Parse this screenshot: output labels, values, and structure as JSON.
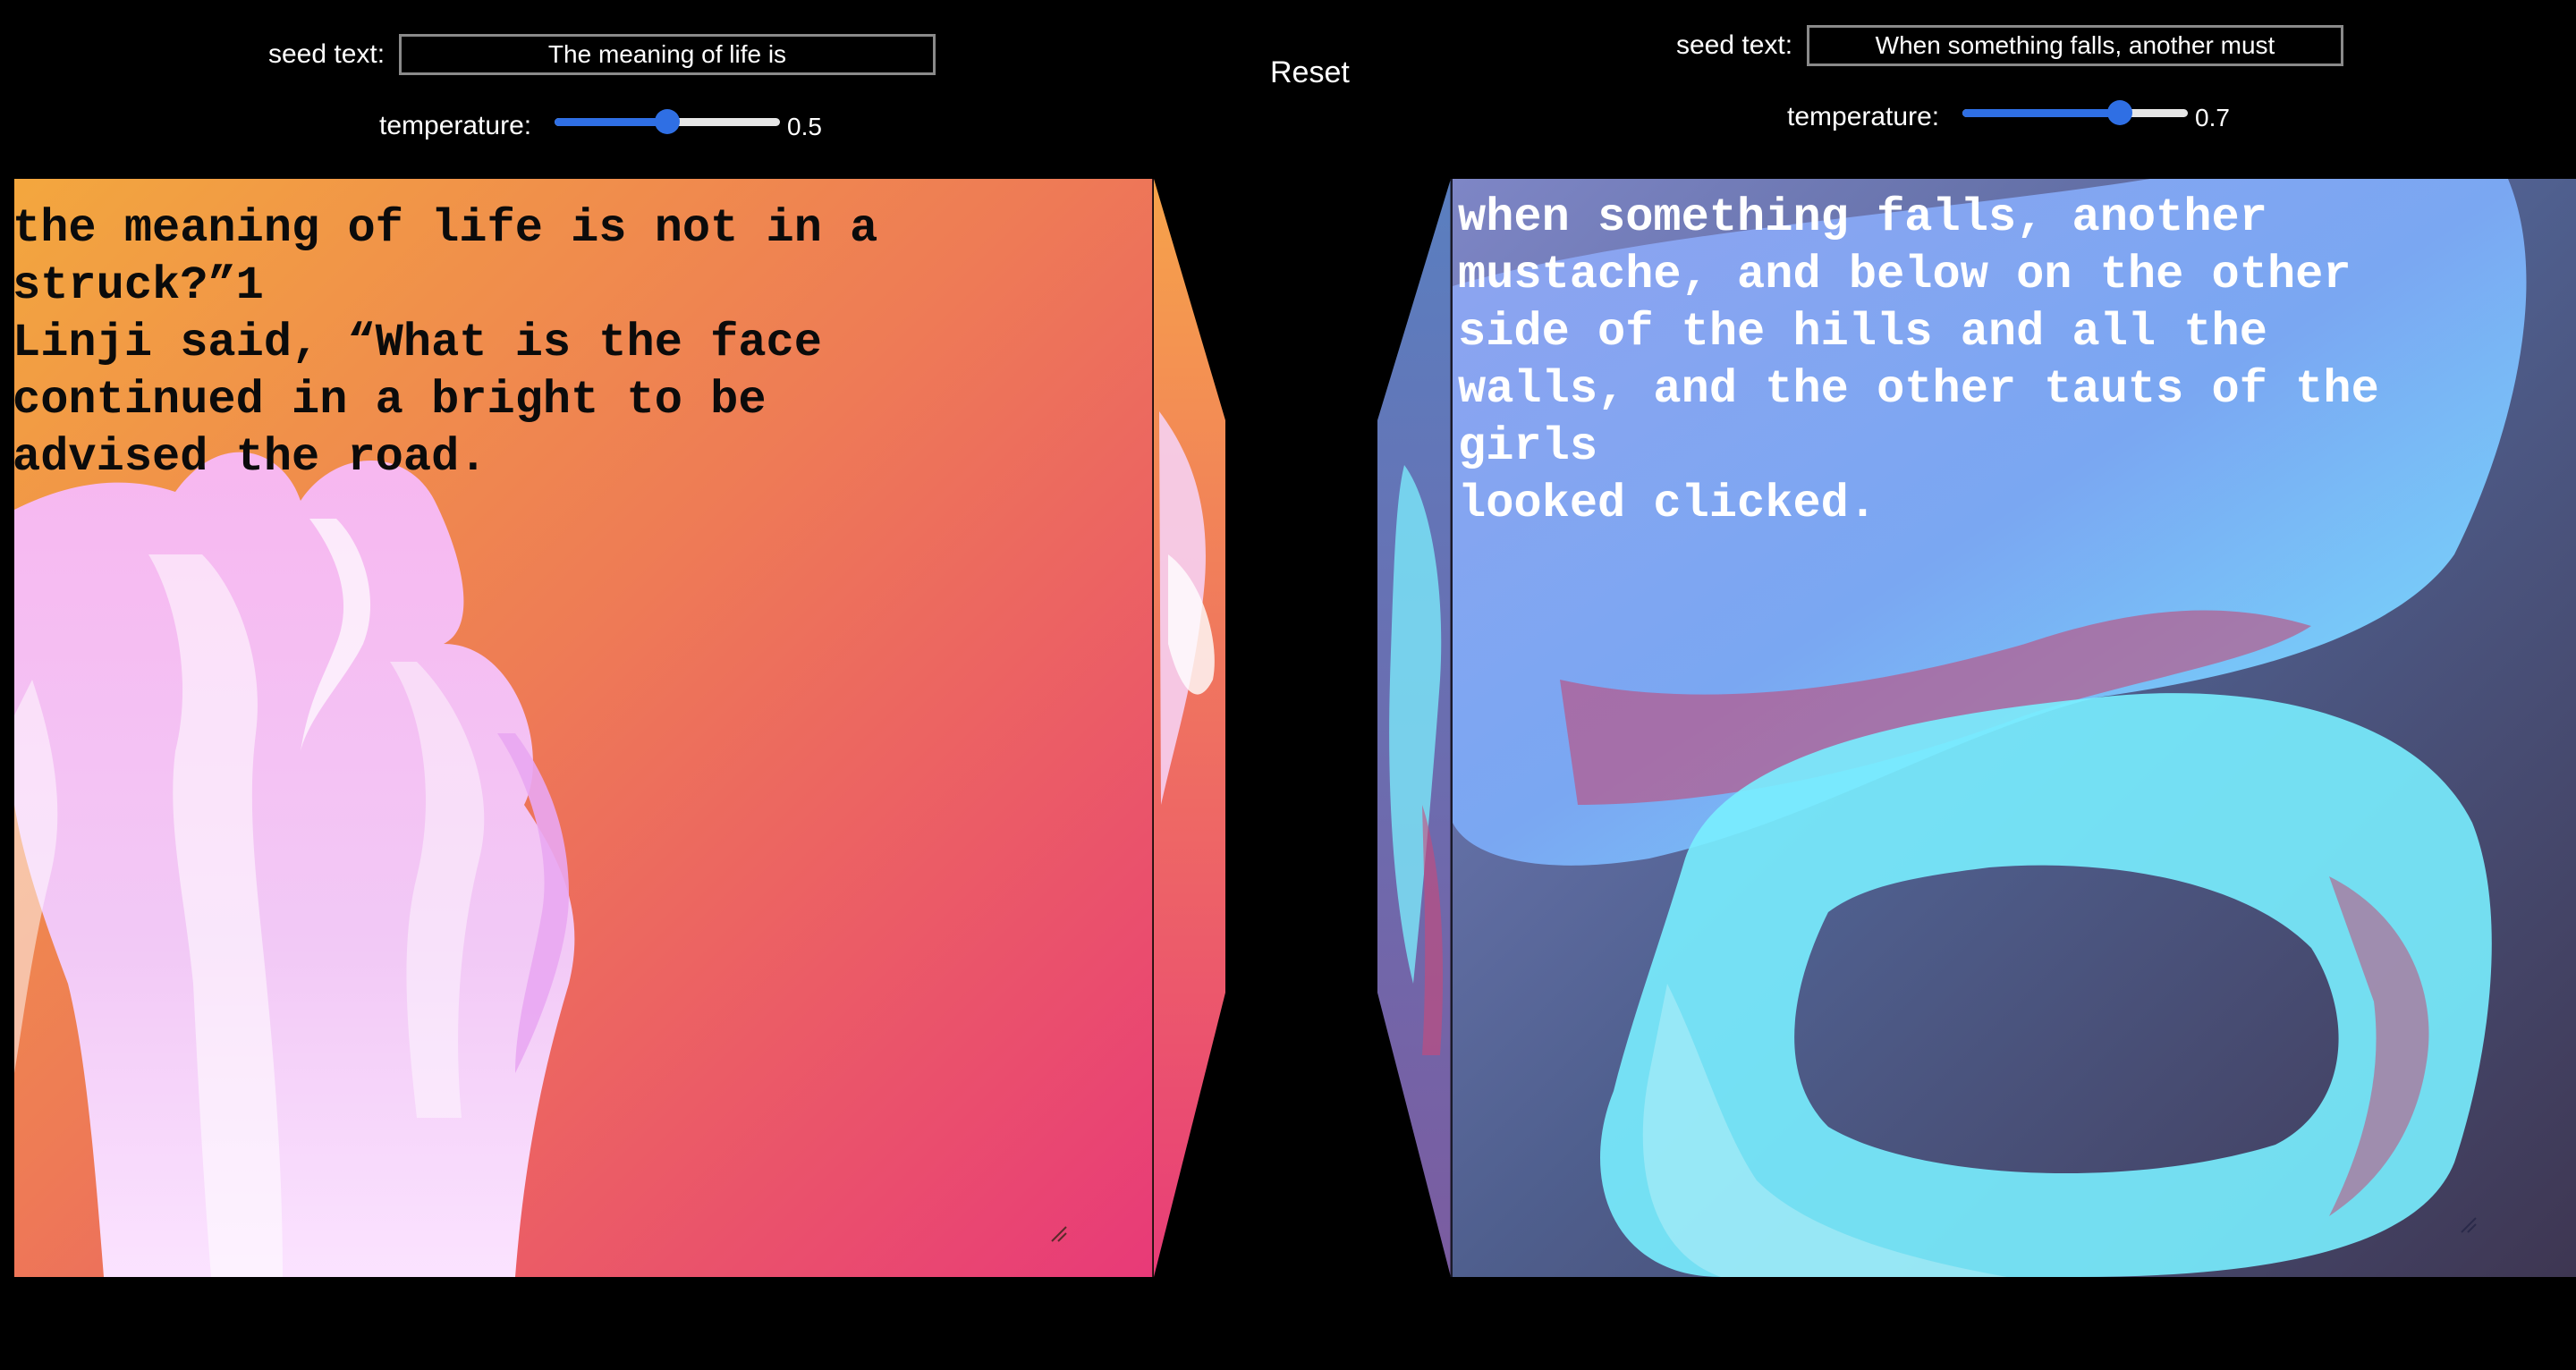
{
  "left_panel": {
    "seed_label": "seed text:",
    "seed_value": "The meaning of life is",
    "temperature_label": "temperature:",
    "temperature_value": 0.5,
    "temperature_text": "0.5",
    "generated_text": "the meaning of life is not in a\nstruck?”1\nLinji said, “What is the face\ncontinued in a bright to be\nadvised the road."
  },
  "right_panel": {
    "seed_label": "seed text:",
    "seed_value": "When something falls, another must",
    "temperature_label": "temperature:",
    "temperature_value": 0.7,
    "temperature_text": "0.7",
    "generated_text": "when something falls, another\nmustache, and below on the other\nside of the hills and all the\nwalls, and the other tauts of the\ngirls\nlooked clicked."
  },
  "reset_label": "Reset",
  "colors": {
    "accent": "#2f6fe4",
    "left_gradient": [
      "#f3a23a",
      "#ea3b76"
    ],
    "right_gradient": [
      "#6c84c4",
      "#3f3856"
    ]
  }
}
